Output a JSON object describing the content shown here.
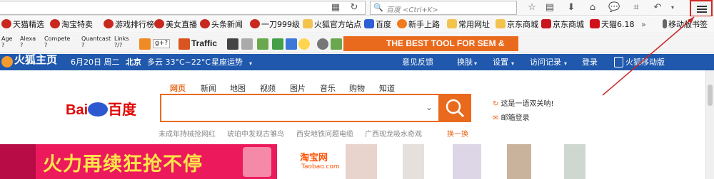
{
  "toolbar": {
    "search_placeholder": "百度 <Ctrl+K>"
  },
  "bookmarks_row1": [
    {
      "label": "天猫精选"
    },
    {
      "label": "淘宝特卖"
    },
    {
      "label": "游戏排行榜"
    },
    {
      "label": "美女直播"
    },
    {
      "label": "头条新闻"
    },
    {
      "label": "一刀999级"
    },
    {
      "label": "火狐官方站点"
    },
    {
      "label": "百度"
    },
    {
      "label": "新手上路"
    },
    {
      "label": "常用网址"
    },
    {
      "label": "京东商城"
    },
    {
      "label": "京东商城"
    },
    {
      "label": "天猫6.18"
    },
    {
      "label": "移动版书签"
    }
  ],
  "bookmarks_row2": {
    "age": "Age",
    "age_val": "?",
    "alexa": "Alexa",
    "alexa_val": "?",
    "compete": "Compete",
    "compete_val": "?",
    "quantcast": "Quantcast",
    "quantcast_val": "?",
    "links": "Links",
    "links_val": "?/?",
    "traffic": "Traffic",
    "gplus": "g+?",
    "banner": "THE BEST TOOL FOR SEM & SEO!"
  },
  "header": {
    "site_name": "火狐主页",
    "date": "6月20日 周二",
    "city": "北京",
    "weather": "多云 33°C~22°C",
    "horoscope": "星座运势",
    "feedback": "意见反馈",
    "skin": "换肤",
    "settings": "设置",
    "history": "访问记录",
    "login": "登录",
    "mobile": "火狐移动版"
  },
  "search": {
    "tabs": [
      "网页",
      "新闻",
      "地图",
      "视频",
      "图片",
      "音乐",
      "购物",
      "知道"
    ],
    "active_tab": "网页",
    "logo": "百度",
    "hot_words": [
      "未成年持械抢网红",
      "琥珀中发现古雏鸟",
      "西安地铁问题电缆",
      "广西现龙吸水奇观"
    ],
    "refresh": "换一换",
    "notice": "这是一语双关呐!",
    "mail_login": "邮箱登录"
  },
  "promo": {
    "headline": "火力再续狂抢不停",
    "taobao": "淘宝网",
    "taobao_url": "Taobao.com"
  },
  "colors": {
    "accent": "#ea6a1d",
    "header_bg": "#1f58ad",
    "highlight": "#d0261f"
  }
}
